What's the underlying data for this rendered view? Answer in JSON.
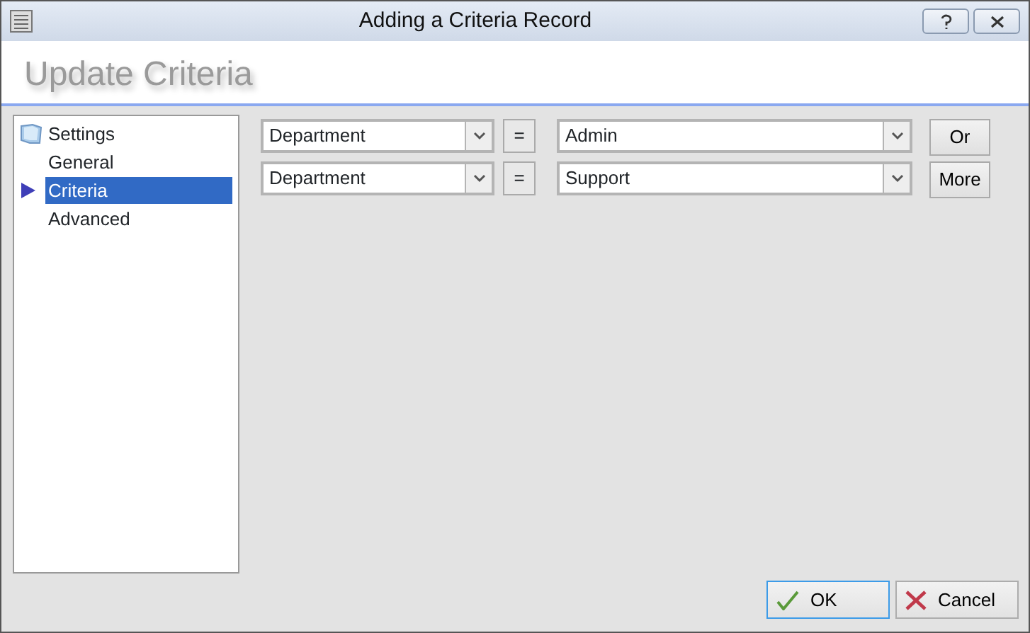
{
  "window": {
    "title": "Adding a Criteria Record"
  },
  "header": {
    "title": "Update Criteria"
  },
  "tree": [
    {
      "label": "Settings",
      "selected": false,
      "children": [
        {
          "label": "General",
          "selected": false
        },
        {
          "label": "Criteria",
          "selected": true
        },
        {
          "label": "Advanced",
          "selected": false
        }
      ]
    }
  ],
  "criteria": [
    {
      "field": "Department",
      "operator": "=",
      "value": "Admin",
      "action": "Or"
    },
    {
      "field": "Department",
      "operator": "=",
      "value": "Support",
      "action": "More"
    }
  ],
  "buttons": [
    {
      "label": "OK",
      "kind": "ok",
      "focused": true
    },
    {
      "label": "Cancel",
      "kind": "cancel",
      "focused": false
    }
  ]
}
